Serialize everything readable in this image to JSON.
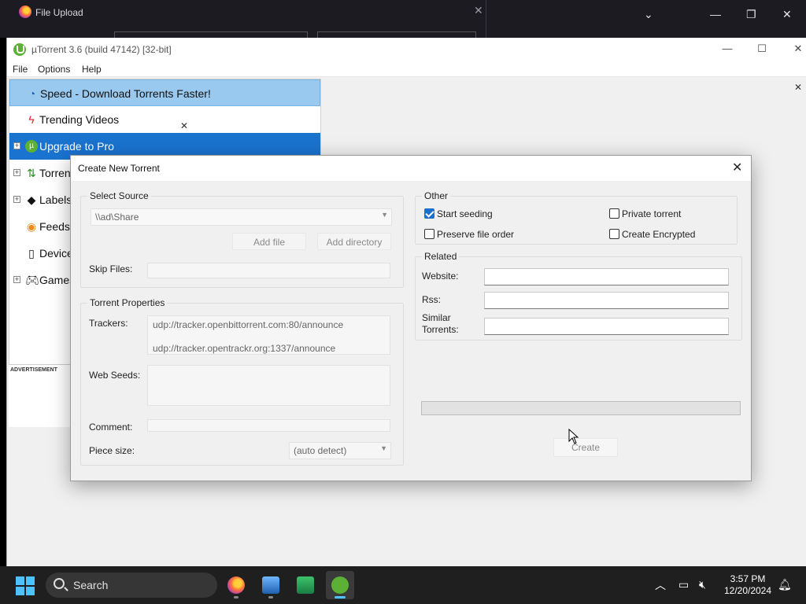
{
  "firefox": {
    "dialog_title": "File Upload"
  },
  "utorrent": {
    "title": "µTorrent 3.6  (build 47142) [32-bit]",
    "menu": [
      "File",
      "Options",
      "Help"
    ],
    "sidebar": [
      {
        "label": "Speed - Download Torrents Faster!",
        "icon": "speed-icon"
      },
      {
        "label": "Trending Videos",
        "icon": "lightning-icon"
      },
      {
        "label": "Upgrade to Pro",
        "icon": "utorrent-logo-icon"
      },
      {
        "label": "Torrent",
        "icon": "transfer-arrows-icon"
      },
      {
        "label": "Labels",
        "icon": "tag-icon"
      },
      {
        "label": "Feeds",
        "icon": "rss-icon"
      },
      {
        "label": "Device",
        "icon": "device-icon"
      },
      {
        "label": "Games",
        "icon": "gamepad-icon"
      }
    ],
    "advertisement_label": "ADVERTISEMENT"
  },
  "dialog": {
    "title": "Create New Torrent",
    "select_source": {
      "group_title": "Select Source",
      "path_value": "\\\\ad\\Share",
      "add_file": "Add file",
      "add_directory": "Add directory",
      "skip_files_label": "Skip Files:"
    },
    "torrent_properties": {
      "group_title": "Torrent Properties",
      "trackers_label": "Trackers:",
      "trackers": [
        "udp://tracker.openbittorrent.com:80/announce",
        "udp://tracker.opentrackr.org:1337/announce"
      ],
      "web_seeds_label": "Web Seeds:",
      "comment_label": "Comment:",
      "piece_size_label": "Piece size:",
      "piece_size_value": "(auto detect)"
    },
    "other": {
      "group_title": "Other",
      "start_seeding": {
        "label": "Start seeding",
        "checked": true
      },
      "private_torrent": {
        "label": "Private torrent",
        "checked": false
      },
      "preserve_file_order": {
        "label": "Preserve file order",
        "checked": false
      },
      "create_encrypted": {
        "label": "Create Encrypted",
        "checked": false
      }
    },
    "related": {
      "group_title": "Related",
      "website_label": "Website:",
      "rss_label": "Rss:",
      "similar_label_1": "Similar",
      "similar_label_2": "Torrents:"
    },
    "create_button": "Create"
  },
  "taskbar": {
    "search_placeholder": "Search",
    "time": "3:57 PM",
    "date": "12/20/2024",
    "apps": [
      "firefox-icon",
      "app-graph-icon",
      "app-green-icon",
      "utorrent-icon"
    ]
  }
}
